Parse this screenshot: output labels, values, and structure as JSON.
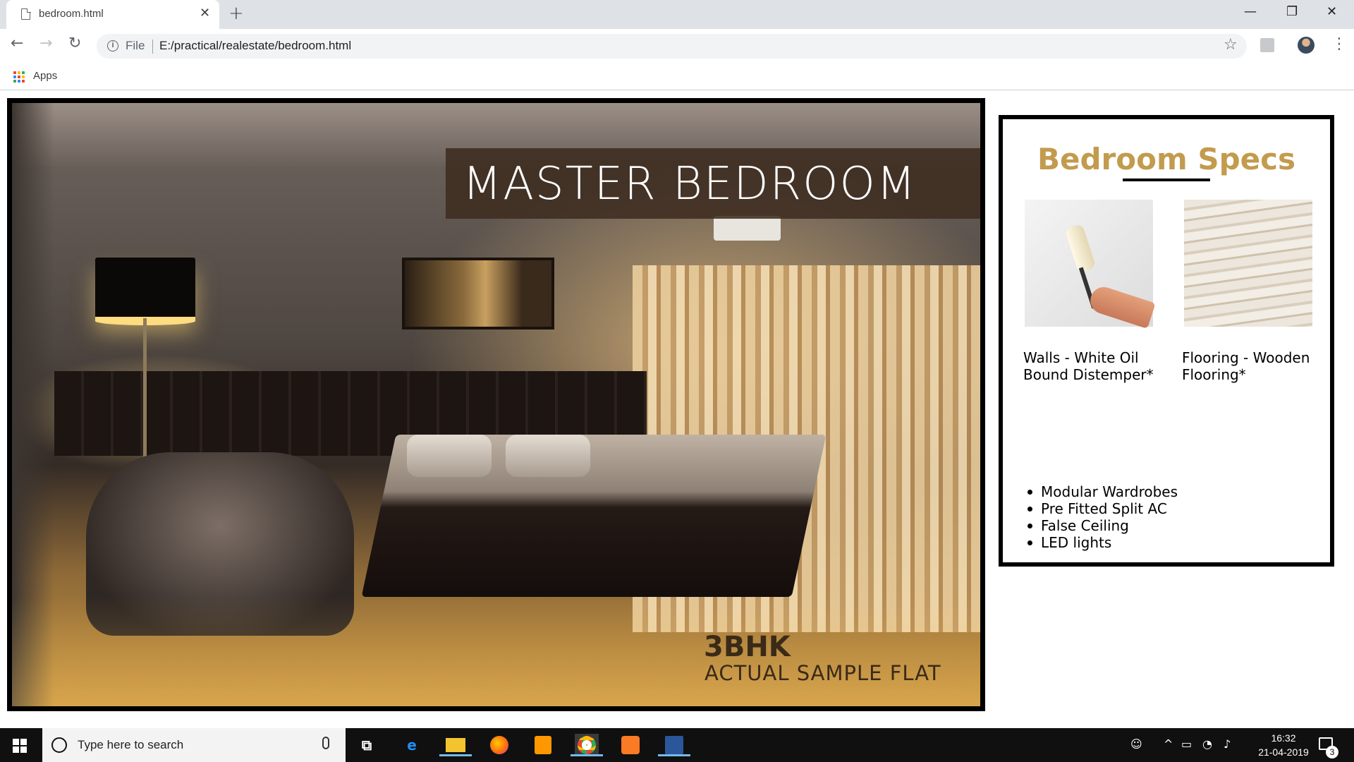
{
  "browser": {
    "tab_title": "bedroom.html",
    "tab_close": "✕",
    "new_tab": "+",
    "window_controls": {
      "minimize": "—",
      "restore": "❐",
      "close": "✕"
    },
    "nav": {
      "back": "←",
      "forward": "→",
      "reload": "↻"
    },
    "omnibox": {
      "info": "i",
      "scheme": "File",
      "url": "E:/practical/realestate/bedroom.html"
    },
    "star": "☆",
    "menu": "⋮",
    "bookmarks": {
      "apps_label": "Apps"
    }
  },
  "hero": {
    "banner_title": "MASTER BEDROOM",
    "flat_type": "3BHK",
    "flat_desc": "ACTUAL SAMPLE FLAT"
  },
  "specs": {
    "title": "Bedroom Specs",
    "items": [
      {
        "caption": "Walls - White Oil Bound Distemper*",
        "icon": "paint-roller"
      },
      {
        "caption": "Flooring - Wooden Flooring*",
        "icon": "marble-floor"
      }
    ],
    "features": [
      "Modular Wardrobes",
      "Pre Fitted Split AC",
      "False Ceiling",
      "LED lights"
    ]
  },
  "taskbar": {
    "search_placeholder": "Type here to search",
    "time": "16:32",
    "date": "21-04-2019",
    "notifications": "3",
    "apps": [
      "task-view",
      "edge",
      "file-explorer",
      "firefox",
      "sublime-text",
      "chrome",
      "xampp",
      "word"
    ]
  },
  "colors": {
    "specs_title": "#c29b4e",
    "banner_bg": "#3e2c20",
    "taskbar": "#101010"
  }
}
